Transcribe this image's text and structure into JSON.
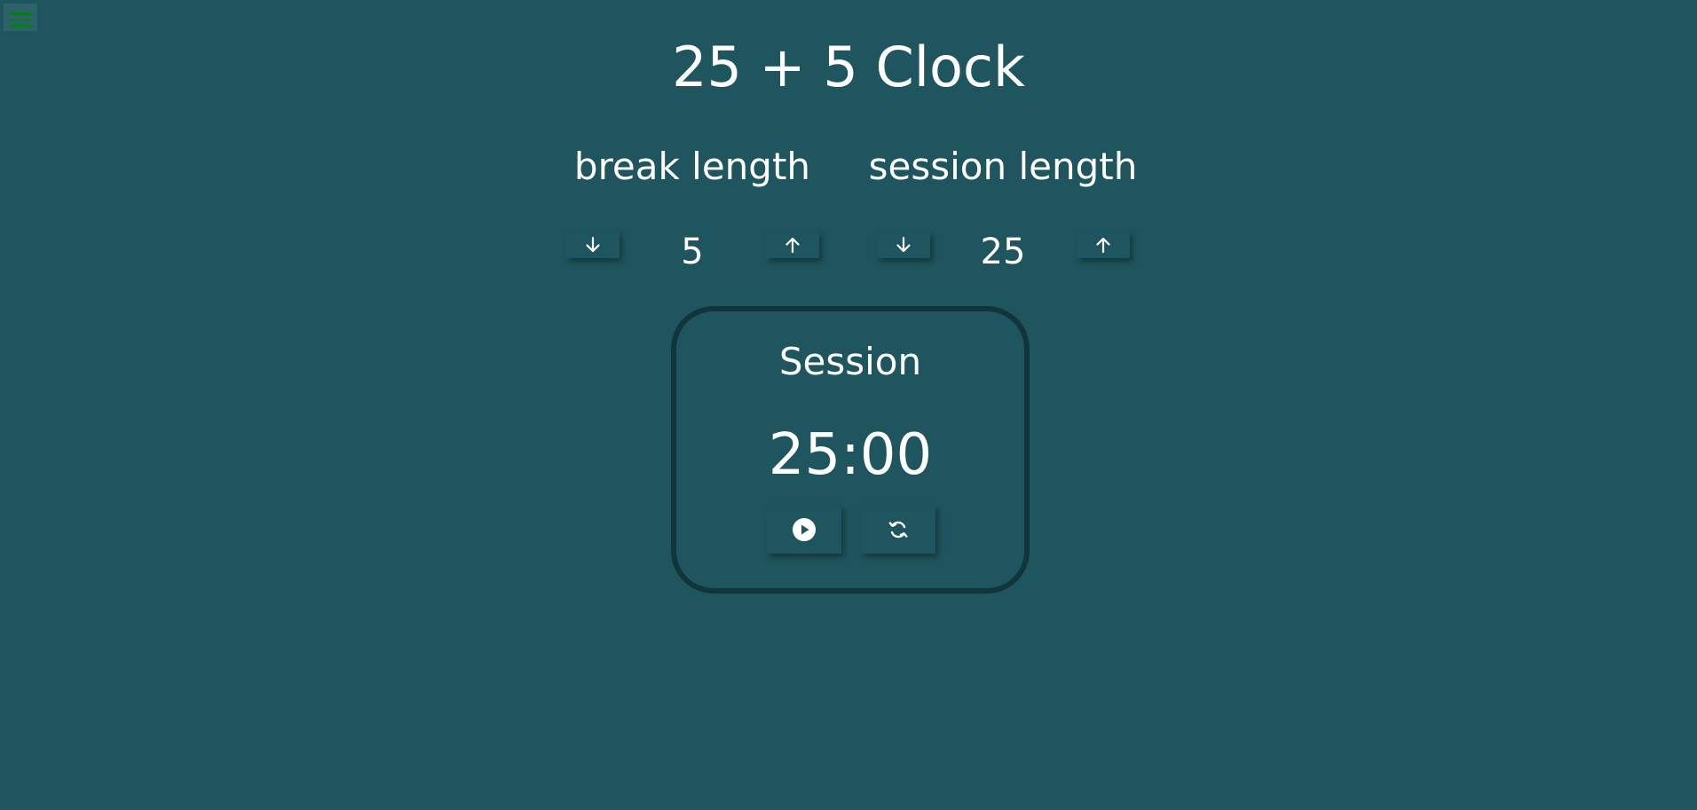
{
  "title": "25 + 5 Clock",
  "break": {
    "label": "break length",
    "value": "5",
    "decrement_icon": "arrow-down-icon",
    "increment_icon": "arrow-up-icon"
  },
  "session": {
    "label": "session length",
    "value": "25",
    "decrement_icon": "arrow-down-icon",
    "increment_icon": "arrow-up-icon"
  },
  "timer": {
    "label": "Session",
    "time_left": "25:00",
    "start_icon": "play-circle-icon",
    "reset_icon": "refresh-icon"
  },
  "menu": {
    "icon": "hamburger-menu-icon"
  },
  "colors": {
    "background": "#1f555e",
    "timer_border": "#11353b",
    "menu_lines": "#0a7a1e",
    "text": "#ffffff"
  }
}
